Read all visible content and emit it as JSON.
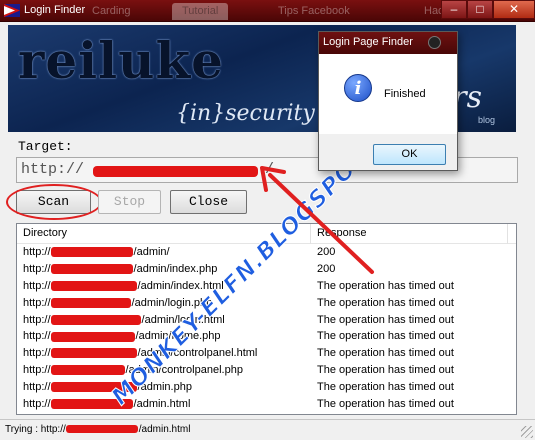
{
  "window": {
    "title": "Login Finder",
    "ghost_tabs": [
      "Carding",
      "Tutorial",
      "Tips Facebook",
      "Hack"
    ],
    "minimize": "–",
    "maximize": "□",
    "close": "✕"
  },
  "banner": {
    "logo_text": "reiluke",
    "tagline": "{in}security at i",
    "right_text": "y ers",
    "sub_text": "blog"
  },
  "target": {
    "label": "Target:",
    "prefix": "http://",
    "suffix": "/"
  },
  "buttons": {
    "scan": "Scan",
    "stop": "Stop",
    "close": "Close"
  },
  "results": {
    "columns": [
      "Directory",
      "Response"
    ],
    "rows": [
      {
        "prefix": "http://",
        "path": "/admin/",
        "response": "200"
      },
      {
        "prefix": "http://",
        "path": "/admin/index.php",
        "response": "200"
      },
      {
        "prefix": "http://",
        "path": "/admin/index.html",
        "response": "The operation has timed out"
      },
      {
        "prefix": "http://",
        "path": "/admin/login.php",
        "response": "The operation has timed out"
      },
      {
        "prefix": "http://",
        "path": "/admin/login.html",
        "response": "The operation has timed out"
      },
      {
        "prefix": "http://",
        "path": "/admin/home.php",
        "response": "The operation has timed out"
      },
      {
        "prefix": "http://",
        "path": "/admin/controlpanel.html",
        "response": "The operation has timed out"
      },
      {
        "prefix": "http://",
        "path": "/admin/controlpanel.php",
        "response": "The operation has timed out"
      },
      {
        "prefix": "http://",
        "path": "/admin.php",
        "response": "The operation has timed out"
      },
      {
        "prefix": "http://",
        "path": "/admin.html",
        "response": "The operation has timed out"
      }
    ]
  },
  "status": {
    "prefix": "Trying : http://",
    "suffix": "/admin.html"
  },
  "watermark": "MONKEY-ELFN.BLOGSPOT.COM",
  "dialog": {
    "title": "Login Page Finder",
    "icon": "i",
    "message": "Finished",
    "ok": "OK"
  },
  "colors": {
    "titlebar": "#6f1111",
    "redaction": "#e21515",
    "annotation": "#e02020",
    "watermark": "#1f5ee0"
  }
}
